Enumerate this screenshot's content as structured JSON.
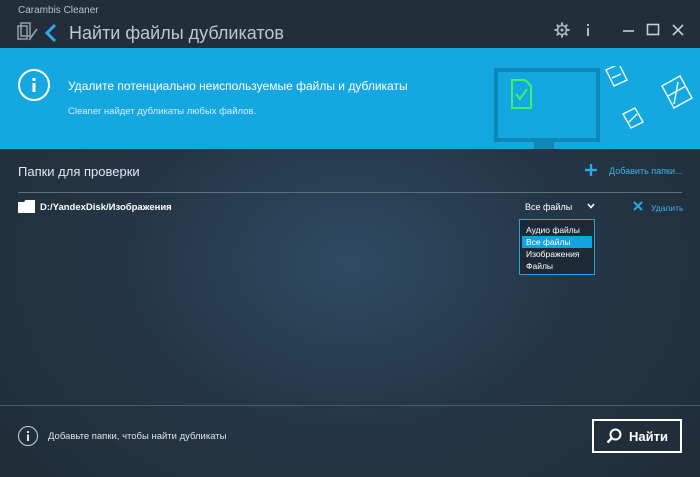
{
  "window": {
    "app_name": "Carambis Cleaner",
    "page_title": "Найти файлы дубликатов",
    "icons": [
      "broom-icon",
      "back-arrow-icon",
      "gear-icon",
      "info-icon",
      "minimize-icon",
      "maximize-icon",
      "close-icon"
    ]
  },
  "banner": {
    "heading": "Удалите потенциально неиспользуемые файлы и дубликаты",
    "subtext": "Cleaner найдет дубликаты любых файлов.",
    "colors": {
      "background": "#15a8e0",
      "accent_green": "#3df26a"
    }
  },
  "folders": {
    "section_title": "Папки для проверки",
    "add_label": "Добавить папки...",
    "rows": [
      {
        "path": "D:/YandexDisk/Изображения",
        "filter_value": "Все файлы",
        "remove_label": "Удалить"
      }
    ]
  },
  "filter_dropdown": {
    "options": [
      "Аудио файлы",
      "Все файлы",
      "Изображения",
      "Файлы"
    ],
    "selected": "Все файлы"
  },
  "footer": {
    "hint": "Добавьте папки, чтобы найти дубликаты",
    "find_label": "Найти"
  }
}
